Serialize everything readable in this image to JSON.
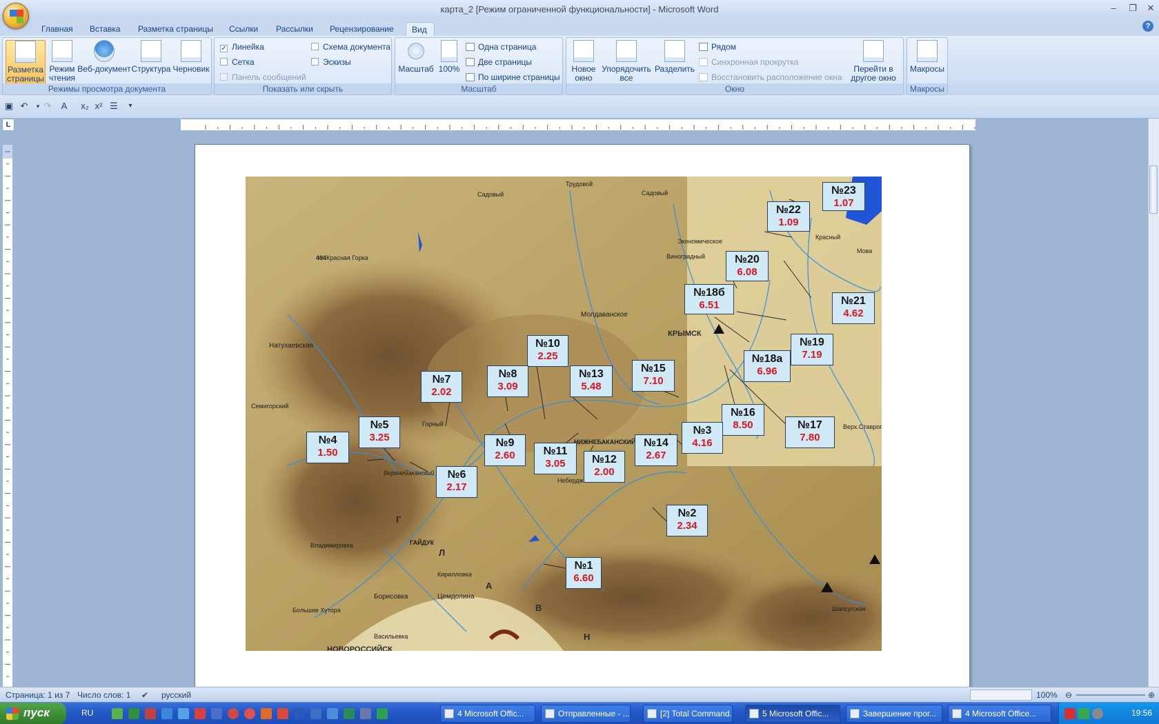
{
  "window": {
    "title": "карта_2 [Режим ограниченной функциональности] - Microsoft Word",
    "minimize_glyph": "–",
    "restore_glyph": "❐",
    "close_glyph": "✕",
    "help_glyph": "?"
  },
  "ribbon_tabs": [
    "Главная",
    "Вставка",
    "Разметка страницы",
    "Ссылки",
    "Рассылки",
    "Рецензирование",
    "Вид"
  ],
  "active_tab": "Вид",
  "groups": {
    "views": {
      "label": "Режимы просмотра документа",
      "buttons": [
        "Разметка страницы",
        "Режим чтения",
        "Веб-документ",
        "Структура",
        "Черновик"
      ]
    },
    "show_hide": {
      "label": "Показать или скрыть",
      "ruler": "Линейка",
      "ruler_checked": true,
      "grid": "Сетка",
      "message_bar": "Панель сообщений",
      "doc_map": "Схема документа",
      "thumbnails": "Эскизы",
      "check_mark": "✓"
    },
    "zoom": {
      "label": "Масштаб",
      "zoom_btn": "Масштаб",
      "pct_btn": "100%",
      "one_page": "Одна страница",
      "two_pages": "Две страницы",
      "page_width": "По ширине страницы"
    },
    "window": {
      "label": "Окно",
      "new_window": "Новое окно",
      "arrange_all": "Упорядочить все",
      "split": "Разделить",
      "side_by_side": "Рядом",
      "sync_scroll": "Синхронная прокрутка",
      "reset_pos": "Восстановить расположение окна",
      "switch_windows": "Перейти в другое окно"
    },
    "macros": {
      "label": "Макросы",
      "macros_btn": "Макросы"
    }
  },
  "quick_access": [
    "save-icon",
    "undo-icon",
    "redo-icon",
    "repeat-icon",
    "text-effects-icon",
    "subscript-icon",
    "superscript-icon",
    "paragraph-icon",
    "customize-icon"
  ],
  "ruler_tab_marker": "L",
  "map": {
    "labels": [
      "Садовый",
      "Трудовой",
      "Садовый",
      "Экономическое",
      "Виноградный",
      "Красный",
      "Мова",
      "г. Красная Горка",
      "464",
      "Натухаевская",
      "Семигорский",
      "Молдаванское",
      "КРЫМСК",
      "Горный",
      "Верхнебаканский",
      "НИЖНЕБАКАНСКИЙ",
      "Неберджаевская",
      "ГАЙДУК",
      "Владимировка",
      "Кирилловка",
      "Борисовка",
      "Цемдолина",
      "Большие Хутора",
      "Васильевка",
      "НОВОРОССИЙСК",
      "Шапсугская",
      "Верх.Ставропольская"
    ],
    "ridge_letters": [
      "Г",
      "Л",
      "А",
      "В",
      "Н"
    ],
    "callouts": [
      {
        "num": "№23",
        "val": "1.07"
      },
      {
        "num": "№22",
        "val": "1.09"
      },
      {
        "num": "№20",
        "val": "6.08"
      },
      {
        "num": "№18б",
        "val": "6.51"
      },
      {
        "num": "№21",
        "val": "4.62"
      },
      {
        "num": "№19",
        "val": "7.19"
      },
      {
        "num": "№18а",
        "val": "6.96"
      },
      {
        "num": "№10",
        "val": "2.25"
      },
      {
        "num": "№7",
        "val": "2.02"
      },
      {
        "num": "№8",
        "val": "3.09"
      },
      {
        "num": "№13",
        "val": "5.48"
      },
      {
        "num": "№15",
        "val": "7.10"
      },
      {
        "num": "№16",
        "val": "8.50"
      },
      {
        "num": "№17",
        "val": "7.80"
      },
      {
        "num": "№5",
        "val": "3.25"
      },
      {
        "num": "№4",
        "val": "1.50"
      },
      {
        "num": "№9",
        "val": "2.60"
      },
      {
        "num": "№11",
        "val": "3.05"
      },
      {
        "num": "№12",
        "val": "2.00"
      },
      {
        "num": "№14",
        "val": "2.67"
      },
      {
        "num": "№3",
        "val": "4.16"
      },
      {
        "num": "№6",
        "val": "2.17"
      },
      {
        "num": "№2",
        "val": "2.34"
      },
      {
        "num": "№1",
        "val": "6.60"
      }
    ]
  },
  "status": {
    "page": "Страница: 1 из 7",
    "words": "Число слов: 1",
    "language": "русский",
    "zoom": "100%"
  },
  "taskbar": {
    "start": "пуск",
    "lang": "RU",
    "buttons": [
      "4 Microsoft Offic...",
      "Отправленные - ...",
      "[2] Total Command...",
      "5 Microsoft Offic...",
      "Завершение прог...",
      "4 Microsoft Office..."
    ],
    "clock": "19:56"
  },
  "colors": {
    "accent": "#15428b",
    "callout_bg": "#cfe9f7",
    "value_red": "#e0141e",
    "taskbar": "#2458c8"
  }
}
